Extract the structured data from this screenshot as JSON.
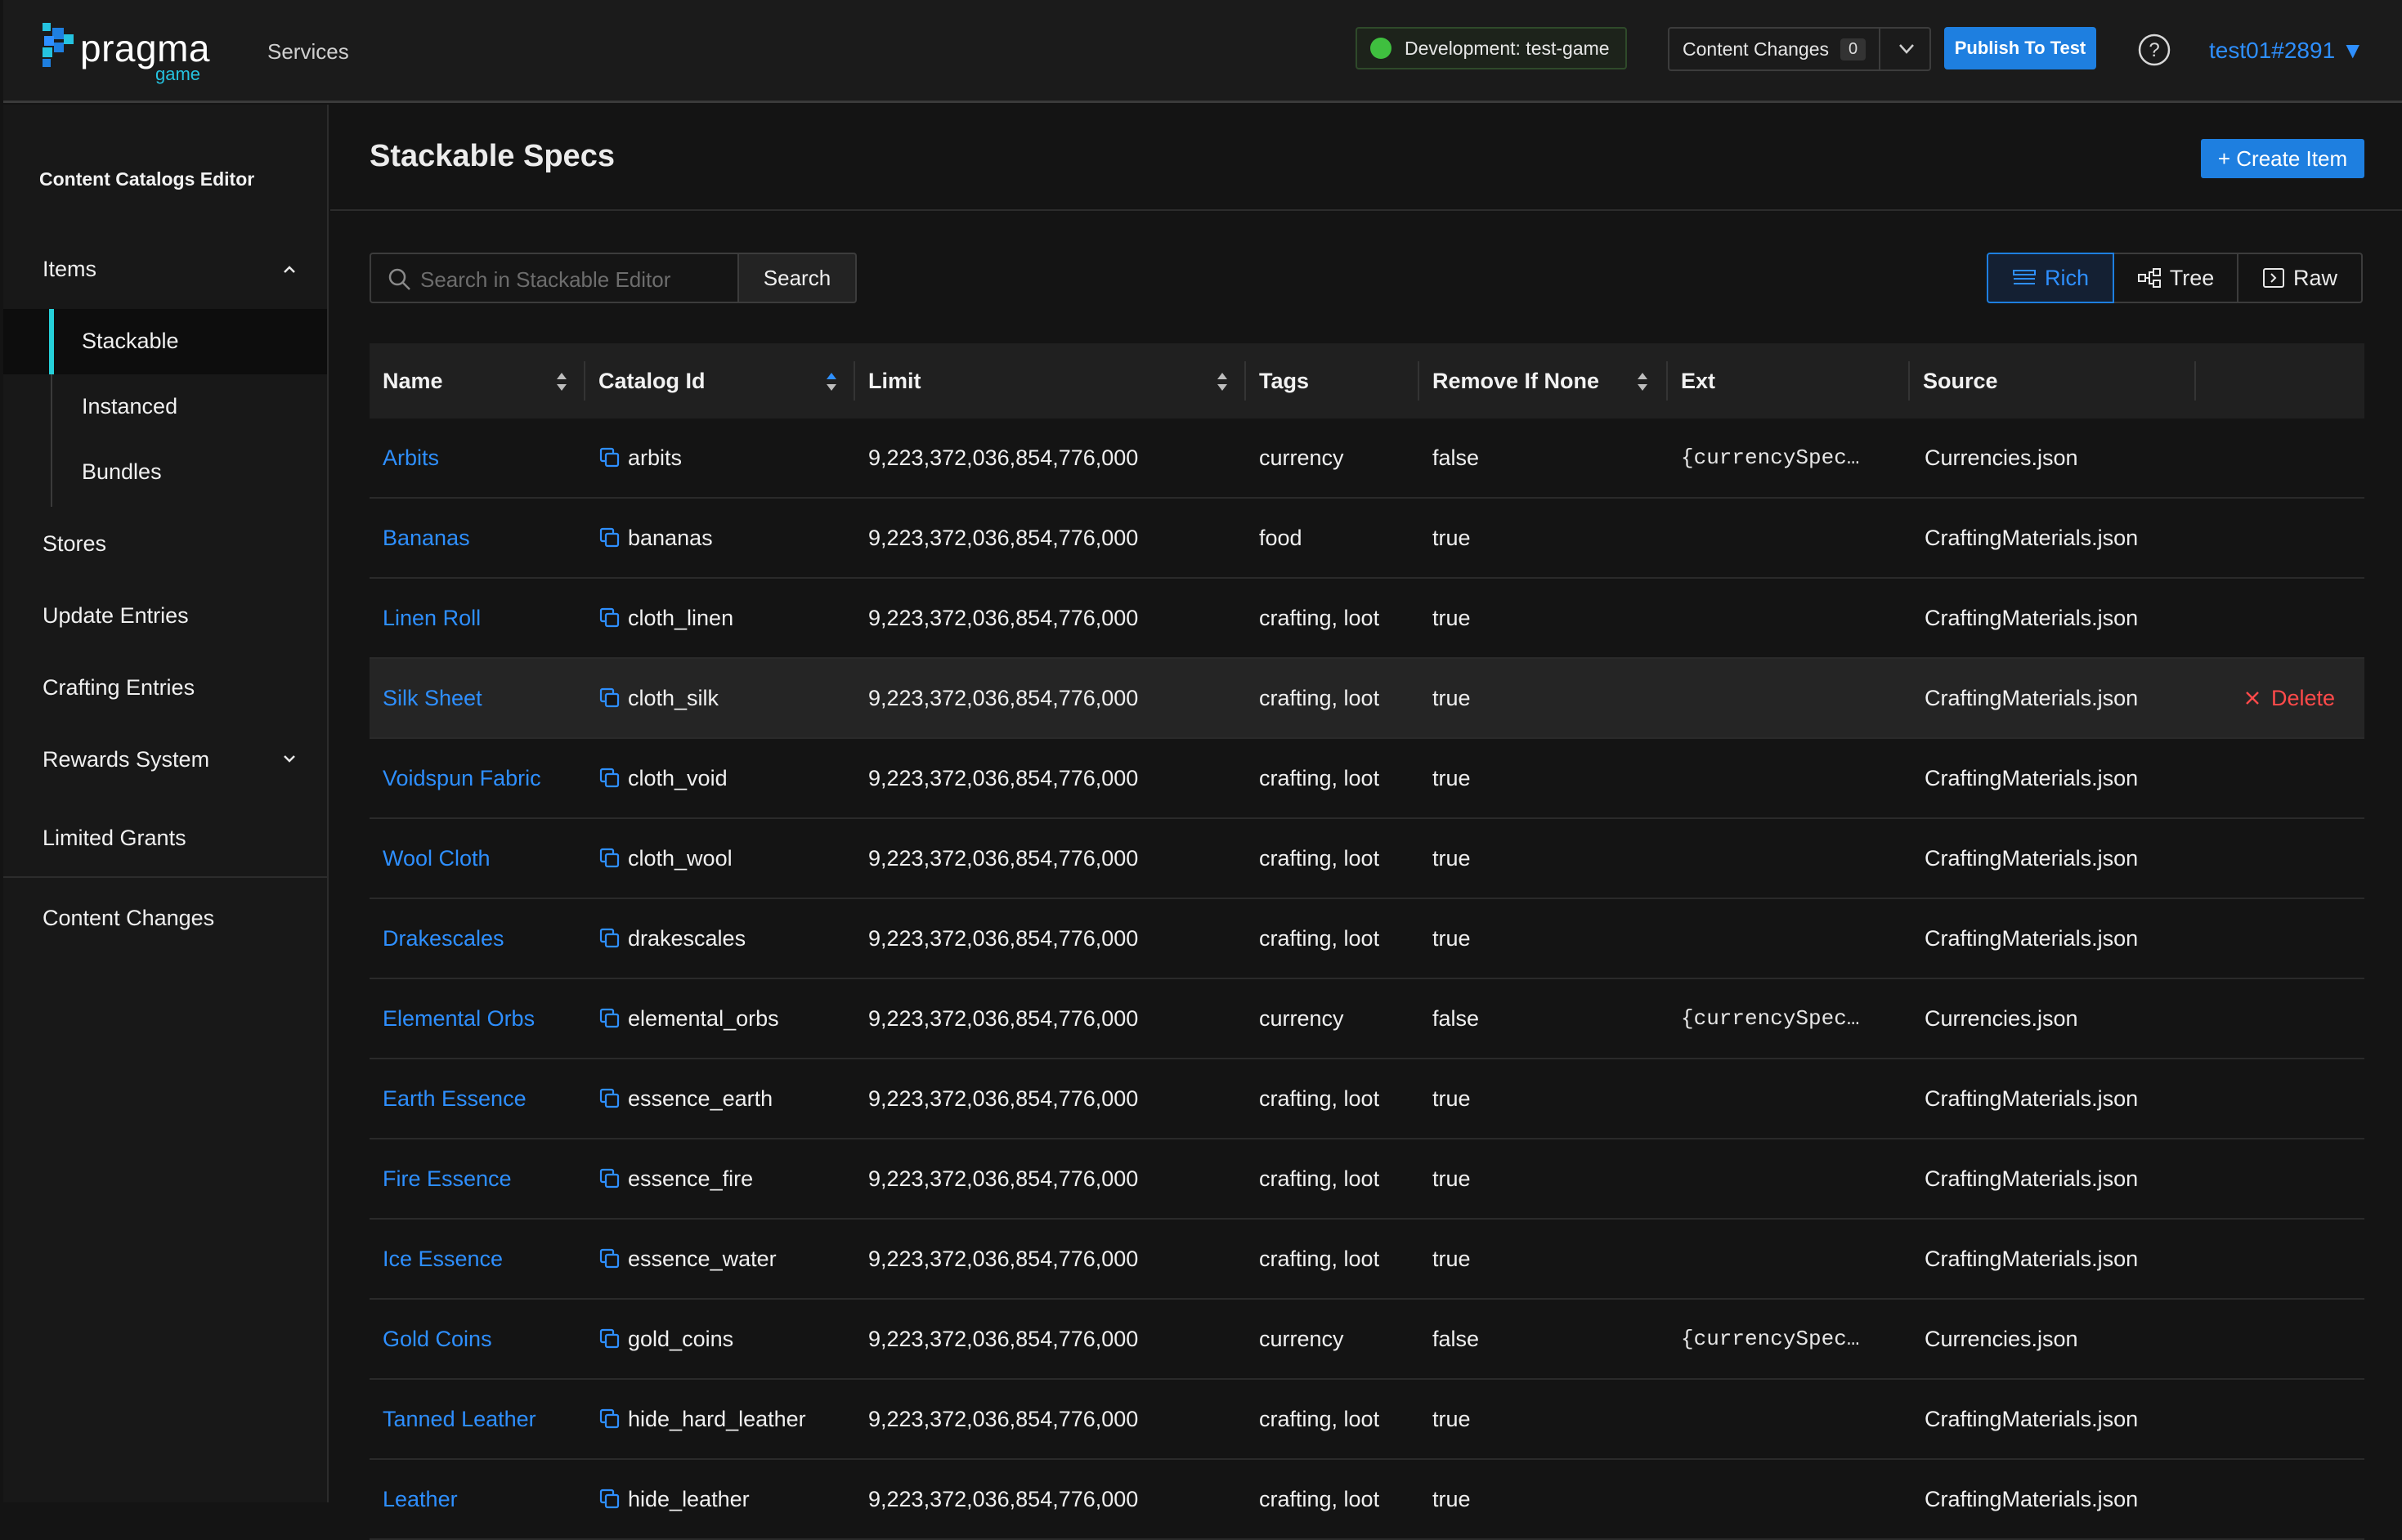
{
  "header": {
    "logo_text": "pragma",
    "logo_sub": "game",
    "nav_services": "Services",
    "env_badge": "Development: test-game",
    "content_changes_label": "Content Changes",
    "content_changes_count": "0",
    "publish_label": "Publish To Test",
    "user": "test01#2891 ▼"
  },
  "sidebar": {
    "title": "Content Catalogs Editor",
    "items_label": "Items",
    "sub_items": [
      "Stackable",
      "Instanced",
      "Bundles"
    ],
    "stores": "Stores",
    "update_entries": "Update Entries",
    "crafting_entries": "Crafting Entries",
    "rewards_system": "Rewards System",
    "limited_grants": "Limited Grants",
    "content_changes": "Content Changes"
  },
  "main": {
    "title": "Stackable Specs",
    "create_label": "+ Create Item",
    "search_placeholder": "Search in Stackable Editor",
    "search_button": "Search",
    "views": [
      "Rich",
      "Tree",
      "Raw"
    ],
    "active_view": "Rich"
  },
  "table": {
    "columns": [
      "Name",
      "Catalog Id",
      "Limit",
      "Tags",
      "Remove If None",
      "Ext",
      "Source"
    ],
    "delete_label": "Delete",
    "rows": [
      {
        "name": "Arbits",
        "id": "arbits",
        "limit": "9,223,372,036,854,776,000",
        "tags": "currency",
        "remove": "false",
        "ext": "{currencySpec…",
        "source": "Currencies.json"
      },
      {
        "name": "Bananas",
        "id": "bananas",
        "limit": "9,223,372,036,854,776,000",
        "tags": "food",
        "remove": "true",
        "ext": "",
        "source": "CraftingMaterials.json"
      },
      {
        "name": "Linen Roll",
        "id": "cloth_linen",
        "limit": "9,223,372,036,854,776,000",
        "tags": "crafting, loot",
        "remove": "true",
        "ext": "",
        "source": "CraftingMaterials.json"
      },
      {
        "name": "Silk Sheet",
        "id": "cloth_silk",
        "limit": "9,223,372,036,854,776,000",
        "tags": "crafting, loot",
        "remove": "true",
        "ext": "",
        "source": "CraftingMaterials.json"
      },
      {
        "name": "Voidspun Fabric",
        "id": "cloth_void",
        "limit": "9,223,372,036,854,776,000",
        "tags": "crafting, loot",
        "remove": "true",
        "ext": "",
        "source": "CraftingMaterials.json"
      },
      {
        "name": "Wool Cloth",
        "id": "cloth_wool",
        "limit": "9,223,372,036,854,776,000",
        "tags": "crafting, loot",
        "remove": "true",
        "ext": "",
        "source": "CraftingMaterials.json"
      },
      {
        "name": "Drakescales",
        "id": "drakescales",
        "limit": "9,223,372,036,854,776,000",
        "tags": "crafting, loot",
        "remove": "true",
        "ext": "",
        "source": "CraftingMaterials.json"
      },
      {
        "name": "Elemental Orbs",
        "id": "elemental_orbs",
        "limit": "9,223,372,036,854,776,000",
        "tags": "currency",
        "remove": "false",
        "ext": "{currencySpec…",
        "source": "Currencies.json"
      },
      {
        "name": "Earth Essence",
        "id": "essence_earth",
        "limit": "9,223,372,036,854,776,000",
        "tags": "crafting, loot",
        "remove": "true",
        "ext": "",
        "source": "CraftingMaterials.json"
      },
      {
        "name": "Fire Essence",
        "id": "essence_fire",
        "limit": "9,223,372,036,854,776,000",
        "tags": "crafting, loot",
        "remove": "true",
        "ext": "",
        "source": "CraftingMaterials.json"
      },
      {
        "name": "Ice Essence",
        "id": "essence_water",
        "limit": "9,223,372,036,854,776,000",
        "tags": "crafting, loot",
        "remove": "true",
        "ext": "",
        "source": "CraftingMaterials.json"
      },
      {
        "name": "Gold Coins",
        "id": "gold_coins",
        "limit": "9,223,372,036,854,776,000",
        "tags": "currency",
        "remove": "false",
        "ext": "{currencySpec…",
        "source": "Currencies.json"
      },
      {
        "name": "Tanned Leather",
        "id": "hide_hard_leather",
        "limit": "9,223,372,036,854,776,000",
        "tags": "crafting, loot",
        "remove": "true",
        "ext": "",
        "source": "CraftingMaterials.json"
      },
      {
        "name": "Leather",
        "id": "hide_leather",
        "limit": "9,223,372,036,854,776,000",
        "tags": "crafting, loot",
        "remove": "true",
        "ext": "",
        "source": "CraftingMaterials.json"
      }
    ],
    "highlighted_row": 3
  },
  "colors": {
    "accent": "#1e7fe0",
    "link": "#2e8fff",
    "active_bar": "#25d0d9",
    "env_dot": "#3fbf3f",
    "danger": "#ff4a4a"
  }
}
